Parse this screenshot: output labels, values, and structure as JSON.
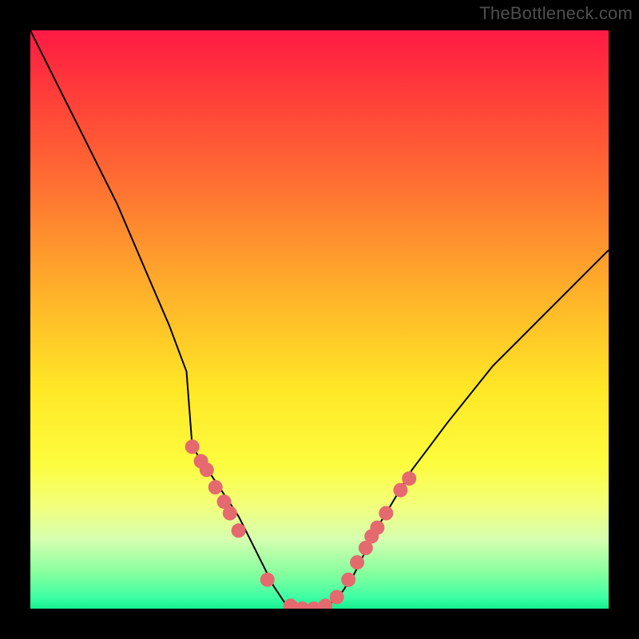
{
  "watermark": "TheBottleneck.com",
  "chart_data": {
    "type": "line",
    "title": "",
    "xlabel": "",
    "ylabel": "",
    "xlim": [
      0,
      100
    ],
    "ylim": [
      0,
      100
    ],
    "series": [
      {
        "name": "curve",
        "x": [
          0,
          3,
          6,
          9,
          12,
          15,
          18,
          21,
          24,
          27,
          28,
          30,
          32,
          34,
          36,
          38,
          40,
          42,
          44,
          46,
          48,
          50,
          52,
          54,
          56,
          58,
          60,
          63,
          66,
          69,
          72,
          76,
          80,
          84,
          88,
          92,
          96,
          100
        ],
        "y": [
          100,
          94,
          88,
          82,
          76,
          70,
          63,
          56,
          49,
          41,
          28,
          25,
          22,
          19,
          16,
          12,
          8,
          4,
          1,
          0,
          0,
          0,
          1,
          3,
          6,
          10,
          14,
          19,
          24,
          28,
          32,
          37,
          42,
          46,
          50,
          54,
          58,
          62
        ]
      }
    ],
    "markers": [
      {
        "x": 28.0,
        "y": 28.0
      },
      {
        "x": 29.5,
        "y": 25.5
      },
      {
        "x": 30.5,
        "y": 24.0
      },
      {
        "x": 32.0,
        "y": 21.0
      },
      {
        "x": 33.5,
        "y": 18.5
      },
      {
        "x": 34.5,
        "y": 16.5
      },
      {
        "x": 36.0,
        "y": 13.5
      },
      {
        "x": 41.0,
        "y": 5.0
      },
      {
        "x": 45.0,
        "y": 0.5
      },
      {
        "x": 47.0,
        "y": 0.0
      },
      {
        "x": 49.0,
        "y": 0.0
      },
      {
        "x": 51.0,
        "y": 0.5
      },
      {
        "x": 53.0,
        "y": 2.0
      },
      {
        "x": 55.0,
        "y": 5.0
      },
      {
        "x": 56.5,
        "y": 8.0
      },
      {
        "x": 58.0,
        "y": 10.5
      },
      {
        "x": 59.0,
        "y": 12.5
      },
      {
        "x": 60.0,
        "y": 14.0
      },
      {
        "x": 61.5,
        "y": 16.5
      },
      {
        "x": 64.0,
        "y": 20.5
      },
      {
        "x": 65.5,
        "y": 22.5
      }
    ]
  }
}
